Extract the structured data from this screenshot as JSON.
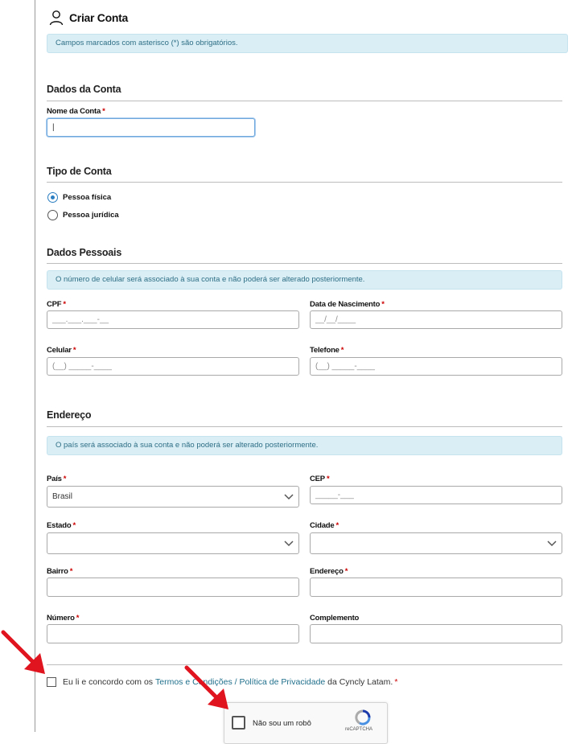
{
  "header": {
    "title": "Criar Conta",
    "icon": "user-icon"
  },
  "notice_required": "Campos marcados com asterisco (*) são obrigatórios.",
  "account": {
    "section_title": "Dados da Conta",
    "name_label": "Nome da Conta",
    "name_value": "|",
    "required_mark": "*"
  },
  "account_type": {
    "section_title": "Tipo de Conta",
    "options": [
      {
        "label": "Pessoa física",
        "selected": true
      },
      {
        "label": "Pessoa jurídica",
        "selected": false
      }
    ]
  },
  "personal": {
    "section_title": "Dados Pessoais",
    "notice": "O número de celular será associado à sua conta e não poderá ser alterado posteriormente.",
    "cpf_label": "CPF",
    "cpf_placeholder": "___.___.___-__",
    "birth_label": "Data de Nascimento",
    "birth_placeholder": "__/__/____",
    "mobile_label": "Celular",
    "mobile_placeholder": "(__) _____-____",
    "phone_label": "Telefone",
    "phone_placeholder": "(__) _____-____"
  },
  "address": {
    "section_title": "Endereço",
    "notice": "O país será associado à sua conta e não poderá ser alterado posteriormente.",
    "country_label": "País",
    "country_value": "Brasil",
    "cep_label": "CEP",
    "cep_placeholder": "_____-___",
    "state_label": "Estado",
    "state_value": "",
    "city_label": "Cidade",
    "city_value": "",
    "district_label": "Bairro",
    "street_label": "Endereço",
    "number_label": "Número",
    "complement_label": "Complemento"
  },
  "terms": {
    "prefix": "Eu li e concordo com os ",
    "link": "Termos e Condições / Política de Privacidade",
    "suffix": " da Cyncly Latam."
  },
  "captcha": {
    "label": "Não sou um robô",
    "brand": "reCAPTCHA"
  },
  "colors": {
    "accent": "#2a7ec1",
    "alert_bg": "#d9eef5",
    "alert_text": "#2f6f86",
    "required": "#cc0000",
    "annotation_arrow": "#e0141e"
  }
}
